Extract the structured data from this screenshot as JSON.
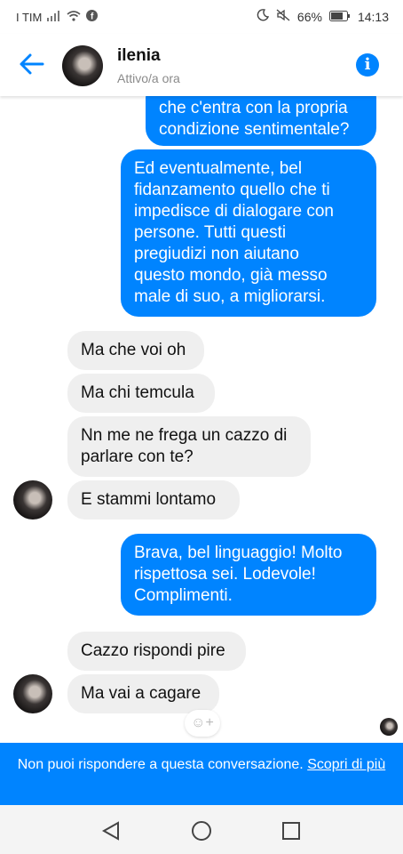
{
  "status_bar": {
    "carrier": "I TIM",
    "battery": "66%",
    "time": "14:13"
  },
  "header": {
    "contact_name": "ilenia",
    "contact_status": "Attivo/a ora"
  },
  "messages": [
    {
      "from": "me",
      "text": "che c'entra con la propria\ncondizione sentimentale?"
    },
    {
      "from": "me",
      "text": "Ed eventualmente, bel\nfidanzamento quello che ti\nimpedisce di dialogare con\npersone. Tutti questi\npregiudizi non aiutano\nquesto mondo, già messo\nmale di suo, a migliorarsi."
    },
    {
      "from": "them",
      "text": "Ma che voi oh"
    },
    {
      "from": "them",
      "text": "Ma chi temcula"
    },
    {
      "from": "them",
      "text": "Nn me ne frega un cazzo di\nparlare con te?"
    },
    {
      "from": "them",
      "text": "E stammi lontamo"
    },
    {
      "from": "me",
      "text": "Brava, bel linguaggio! Molto\nrispettosa sei. Lodevole!\nComplimenti."
    },
    {
      "from": "them",
      "text": "Cazzo rispondi pire"
    },
    {
      "from": "them",
      "text": "Ma vai a cagare"
    }
  ],
  "banner": {
    "text": "Non puoi rispondere a questa conversazione.",
    "link": "Scopri di più"
  },
  "colors": {
    "accent": "#0084ff",
    "incoming_bubble": "#efefef"
  },
  "icons": [
    "back-arrow-icon",
    "info-icon",
    "add-reaction-icon",
    "nav-back-icon",
    "nav-home-icon",
    "nav-recents-icon"
  ]
}
